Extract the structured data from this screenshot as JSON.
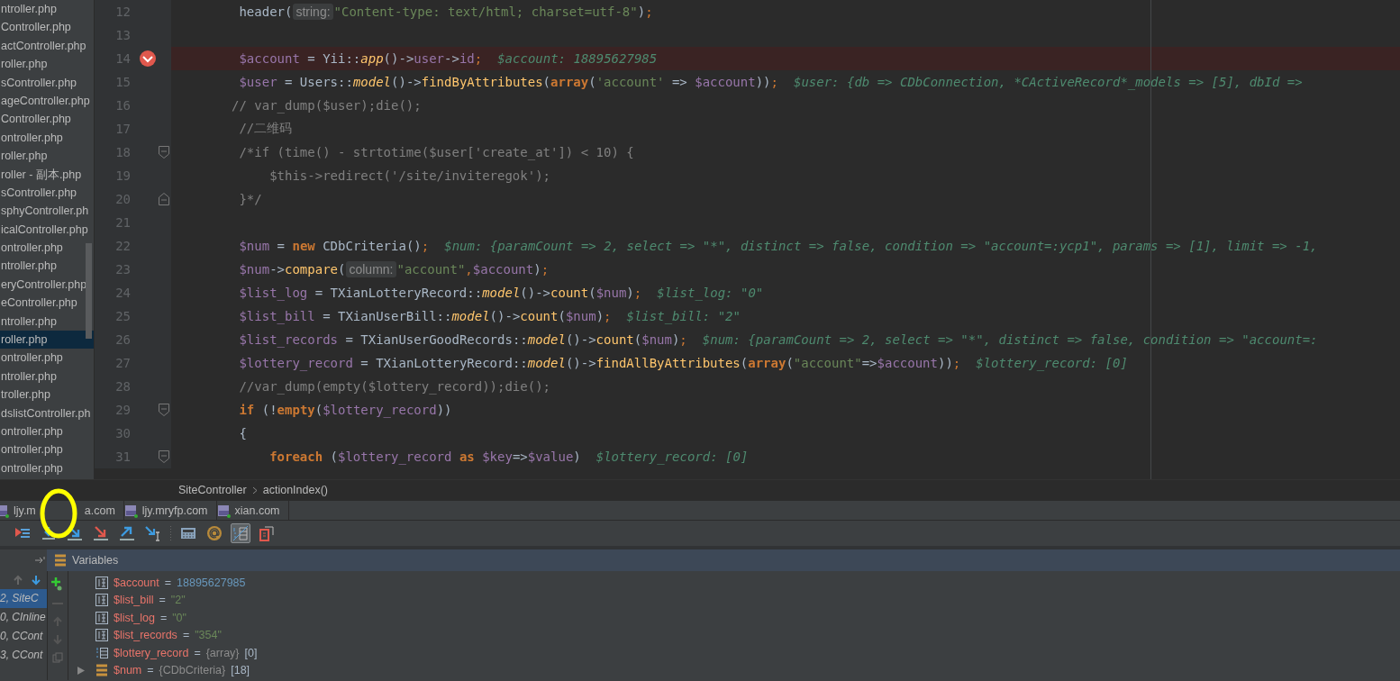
{
  "project_tree": {
    "items": [
      {
        "label": "ntroller.php",
        "selected": false
      },
      {
        "label": "Controller.php",
        "selected": false
      },
      {
        "label": "actController.php",
        "selected": false
      },
      {
        "label": "roller.php",
        "selected": false
      },
      {
        "label": "sController.php",
        "selected": false
      },
      {
        "label": "ageController.php",
        "selected": false
      },
      {
        "label": "Controller.php",
        "selected": false
      },
      {
        "label": "ontroller.php",
        "selected": false
      },
      {
        "label": "roller.php",
        "selected": false
      },
      {
        "label": "roller - 副本.php",
        "selected": false
      },
      {
        "label": "sController.php",
        "selected": false
      },
      {
        "label": "sphyController.ph",
        "selected": false
      },
      {
        "label": "icalController.php",
        "selected": false
      },
      {
        "label": "ontroller.php",
        "selected": false
      },
      {
        "label": "ntroller.php",
        "selected": false
      },
      {
        "label": "eryController.php",
        "selected": false
      },
      {
        "label": "eController.php",
        "selected": false
      },
      {
        "label": "ntroller.php",
        "selected": false
      },
      {
        "label": "roller.php",
        "selected": true
      },
      {
        "label": "ontroller.php",
        "selected": false
      },
      {
        "label": "ntroller.php",
        "selected": false
      },
      {
        "label": "troller.php",
        "selected": false
      },
      {
        "label": "dslistController.ph",
        "selected": false
      },
      {
        "label": "ontroller.php",
        "selected": false
      },
      {
        "label": "ontroller.php",
        "selected": false
      },
      {
        "label": "ontroller.php",
        "selected": false
      }
    ]
  },
  "editor": {
    "lines": [
      {
        "number": "12",
        "breakpoint": false,
        "tokens": [
          {
            "kind": "plain",
            "text": "        header("
          },
          {
            "kind": "param_hint",
            "text": "string:"
          },
          {
            "kind": "string",
            "text": "\"Content-type: text/html; charset=utf-8\""
          },
          {
            "kind": "plain",
            "text": ")"
          },
          {
            "kind": "punct",
            "text": ";"
          }
        ]
      },
      {
        "number": "13",
        "breakpoint": false
      },
      {
        "number": "14",
        "breakpoint": true,
        "tokens": [
          {
            "kind": "var",
            "text": "        $account"
          },
          {
            "kind": "plain",
            "text": " = Yii::"
          },
          {
            "kind": "static",
            "text": "app"
          },
          {
            "kind": "plain",
            "text": "()->"
          },
          {
            "kind": "var",
            "text": "user"
          },
          {
            "kind": "plain",
            "text": "->"
          },
          {
            "kind": "var",
            "text": "id"
          },
          {
            "kind": "punct",
            "text": ";"
          },
          {
            "kind": "hint",
            "text": "$account: 18895627985"
          }
        ]
      },
      {
        "number": "15",
        "breakpoint": false,
        "tokens": [
          {
            "kind": "var",
            "text": "        $user"
          },
          {
            "kind": "plain",
            "text": " = Users::"
          },
          {
            "kind": "static",
            "text": "model"
          },
          {
            "kind": "plain",
            "text": "()->"
          },
          {
            "kind": "method",
            "text": "findByAttributes"
          },
          {
            "kind": "plain",
            "text": "("
          },
          {
            "kind": "keyword",
            "text": "array"
          },
          {
            "kind": "plain",
            "text": "("
          },
          {
            "kind": "string",
            "text": "'account'"
          },
          {
            "kind": "plain",
            "text": " => "
          },
          {
            "kind": "var",
            "text": "$account"
          },
          {
            "kind": "plain",
            "text": "))"
          },
          {
            "kind": "punct",
            "text": ";"
          },
          {
            "kind": "hint",
            "text": "$user: {db => CDbConnection, *CActiveRecord*_models => [5], dbId =>"
          }
        ]
      },
      {
        "number": "16",
        "breakpoint": false,
        "tokens": [
          {
            "kind": "comment",
            "text": "       // var_dump($user);die();"
          }
        ]
      },
      {
        "number": "17",
        "breakpoint": false,
        "tokens": [
          {
            "kind": "comment",
            "text": "        //二维码"
          }
        ]
      },
      {
        "number": "18",
        "breakpoint": false,
        "fold_start": true,
        "tokens": [
          {
            "kind": "comment",
            "text": "        /*if (time() - strtotime($user['create_at']) < 10) {"
          }
        ]
      },
      {
        "number": "19",
        "breakpoint": false,
        "tokens": [
          {
            "kind": "comment",
            "text": "            $this->redirect('/site/inviteregok');"
          }
        ]
      },
      {
        "number": "20",
        "breakpoint": false,
        "fold_end": true,
        "tokens": [
          {
            "kind": "comment",
            "text": "        }*/"
          }
        ]
      },
      {
        "number": "21",
        "breakpoint": false
      },
      {
        "number": "22",
        "breakpoint": false,
        "tokens": [
          {
            "kind": "var",
            "text": "        $num"
          },
          {
            "kind": "plain",
            "text": " = "
          },
          {
            "kind": "keyword",
            "text": "new"
          },
          {
            "kind": "plain",
            "text": " CDbCriteria()"
          },
          {
            "kind": "punct",
            "text": ";"
          },
          {
            "kind": "hint",
            "text": "$num: {paramCount => 2, select => \"*\", distinct => false, condition => \"account=:ycp1\", params => [1], limit => -1,"
          }
        ]
      },
      {
        "number": "23",
        "breakpoint": false,
        "tokens": [
          {
            "kind": "var",
            "text": "        $num"
          },
          {
            "kind": "plain",
            "text": "->"
          },
          {
            "kind": "method",
            "text": "compare"
          },
          {
            "kind": "plain",
            "text": "("
          },
          {
            "kind": "param_hint",
            "text": "column:"
          },
          {
            "kind": "string",
            "text": "\"account\""
          },
          {
            "kind": "punct",
            "text": ","
          },
          {
            "kind": "var",
            "text": "$account"
          },
          {
            "kind": "plain",
            "text": ")"
          },
          {
            "kind": "punct",
            "text": ";"
          }
        ]
      },
      {
        "number": "24",
        "breakpoint": false,
        "tokens": [
          {
            "kind": "var",
            "text": "        $list_log"
          },
          {
            "kind": "plain",
            "text": " = TXianLotteryRecord::"
          },
          {
            "kind": "static",
            "text": "model"
          },
          {
            "kind": "plain",
            "text": "()->"
          },
          {
            "kind": "method",
            "text": "count"
          },
          {
            "kind": "plain",
            "text": "("
          },
          {
            "kind": "var",
            "text": "$num"
          },
          {
            "kind": "plain",
            "text": ")"
          },
          {
            "kind": "punct",
            "text": ";"
          },
          {
            "kind": "hint",
            "text": "$list_log: \"0\""
          }
        ]
      },
      {
        "number": "25",
        "breakpoint": false,
        "tokens": [
          {
            "kind": "var",
            "text": "        $list_bill"
          },
          {
            "kind": "plain",
            "text": " = TXianUserBill::"
          },
          {
            "kind": "static",
            "text": "model"
          },
          {
            "kind": "plain",
            "text": "()->"
          },
          {
            "kind": "method",
            "text": "count"
          },
          {
            "kind": "plain",
            "text": "("
          },
          {
            "kind": "var",
            "text": "$num"
          },
          {
            "kind": "plain",
            "text": ")"
          },
          {
            "kind": "punct",
            "text": ";"
          },
          {
            "kind": "hint",
            "text": "$list_bill: \"2\""
          }
        ]
      },
      {
        "number": "26",
        "breakpoint": false,
        "tokens": [
          {
            "kind": "var",
            "text": "        $list_records"
          },
          {
            "kind": "plain",
            "text": " = TXianUserGoodRecords::"
          },
          {
            "kind": "static",
            "text": "model"
          },
          {
            "kind": "plain",
            "text": "()->"
          },
          {
            "kind": "method",
            "text": "count"
          },
          {
            "kind": "plain",
            "text": "("
          },
          {
            "kind": "var",
            "text": "$num"
          },
          {
            "kind": "plain",
            "text": ")"
          },
          {
            "kind": "punct",
            "text": ";"
          },
          {
            "kind": "hint",
            "text": "$num: {paramCount => 2, select => \"*\", distinct => false, condition => \"account=:"
          }
        ]
      },
      {
        "number": "27",
        "breakpoint": false,
        "tokens": [
          {
            "kind": "var",
            "text": "        $lottery_record"
          },
          {
            "kind": "plain",
            "text": " = TXianLotteryRecord::"
          },
          {
            "kind": "static",
            "text": "model"
          },
          {
            "kind": "plain",
            "text": "()->"
          },
          {
            "kind": "method",
            "text": "findAllByAttributes"
          },
          {
            "kind": "plain",
            "text": "("
          },
          {
            "kind": "keyword",
            "text": "array"
          },
          {
            "kind": "plain",
            "text": "("
          },
          {
            "kind": "string",
            "text": "\"account\""
          },
          {
            "kind": "plain",
            "text": "=>"
          },
          {
            "kind": "var",
            "text": "$account"
          },
          {
            "kind": "plain",
            "text": "))"
          },
          {
            "kind": "punct",
            "text": ";"
          },
          {
            "kind": "hint",
            "text": "$lottery_record: [0]"
          }
        ]
      },
      {
        "number": "28",
        "breakpoint": false,
        "tokens": [
          {
            "kind": "comment",
            "text": "        //var_dump(empty($lottery_record));die();"
          }
        ]
      },
      {
        "number": "29",
        "breakpoint": false,
        "fold_start": true,
        "tokens": [
          {
            "kind": "keyword",
            "text": "        if"
          },
          {
            "kind": "plain",
            "text": " (!"
          },
          {
            "kind": "keyword",
            "text": "empty"
          },
          {
            "kind": "plain",
            "text": "("
          },
          {
            "kind": "var",
            "text": "$lottery_record"
          },
          {
            "kind": "plain",
            "text": "))"
          }
        ]
      },
      {
        "number": "30",
        "breakpoint": false,
        "tokens": [
          {
            "kind": "plain",
            "text": "        {"
          }
        ]
      },
      {
        "number": "31",
        "breakpoint": false,
        "fold_start": true,
        "tokens": [
          {
            "kind": "keyword",
            "text": "            foreach"
          },
          {
            "kind": "plain",
            "text": " ("
          },
          {
            "kind": "var",
            "text": "$lottery_record"
          },
          {
            "kind": "keyword",
            "text": " as "
          },
          {
            "kind": "var",
            "text": "$key"
          },
          {
            "kind": "plain",
            "text": "=>"
          },
          {
            "kind": "var",
            "text": "$value"
          },
          {
            "kind": "plain",
            "text": ")"
          },
          {
            "kind": "hint",
            "text": "$lottery_record: [0]"
          }
        ]
      }
    ]
  },
  "breadcrumbs": [
    "SiteController",
    "actionIndex()"
  ],
  "editor_tabs": [
    {
      "label": "ljy.m",
      "label_tail": "a.com"
    },
    {
      "label": "ljy.mryfp.com"
    },
    {
      "label": "xian.com"
    }
  ],
  "debug_toolbar": [
    {
      "kind": "execution_point",
      "selected": false
    },
    {
      "kind": "step_over",
      "selected": false
    },
    {
      "kind": "step_into",
      "selected": false
    },
    {
      "kind": "force_step_into",
      "selected": false
    },
    {
      "kind": "step_out",
      "selected": false
    },
    {
      "kind": "run_to_cursor",
      "selected": false
    },
    {
      "kind": "separator"
    },
    {
      "kind": "evaluate",
      "selected": false
    },
    {
      "kind": "watch",
      "selected": false
    },
    {
      "kind": "inline_values",
      "selected": true
    },
    {
      "kind": "restore_layout",
      "selected": false
    }
  ],
  "variables_title": "Variables",
  "frames": [
    {
      "label": "2, SiteC",
      "selected": true
    },
    {
      "label": "0, CInline",
      "selected": false
    },
    {
      "label": "0, CCont",
      "selected": false
    },
    {
      "label": "3, CCont",
      "selected": false
    }
  ],
  "variables": [
    {
      "kind": "primitive",
      "name": "$account",
      "separator": "=",
      "value": "18895627985",
      "color": "#6897bb"
    },
    {
      "kind": "primitive",
      "name": "$list_bill",
      "separator": "=",
      "value": "\"2\"",
      "color": "#6a8759"
    },
    {
      "kind": "primitive",
      "name": "$list_log",
      "separator": "=",
      "value": "\"0\"",
      "color": "#6a8759"
    },
    {
      "kind": "primitive",
      "name": "$list_records",
      "separator": "=",
      "value": "\"354\"",
      "color": "#6a8759"
    },
    {
      "kind": "array",
      "name": "$lottery_record",
      "separator": "=",
      "type": "{array}",
      "value": "[0]",
      "color": "#a9b7c6"
    },
    {
      "kind": "object",
      "name": "$num",
      "separator": "=",
      "type": "{CDbCriteria}",
      "value": "[18]",
      "color": "#a9b7c6"
    }
  ]
}
